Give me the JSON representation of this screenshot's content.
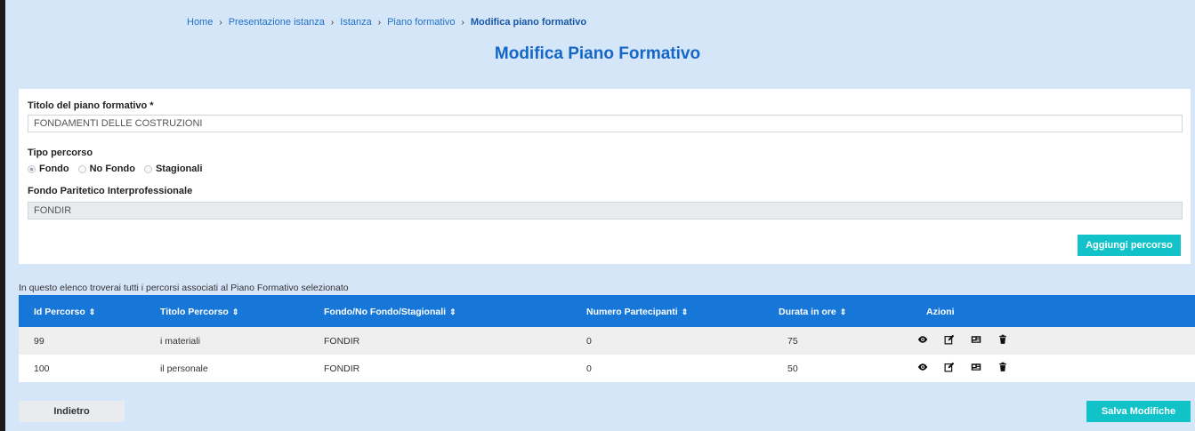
{
  "breadcrumb": {
    "items": [
      "Home",
      "Presentazione istanza",
      "Istanza",
      "Piano formativo"
    ],
    "current": "Modifica piano formativo",
    "separator": "›"
  },
  "page_title": "Modifica Piano Formativo",
  "form": {
    "title_label": "Titolo del piano formativo *",
    "title_value": "FONDAMENTI DELLE COSTRUZIONI",
    "tipo_label": "Tipo percorso",
    "tipo_options": [
      "Fondo",
      "No Fondo",
      "Stagionali"
    ],
    "tipo_selected": "Fondo",
    "fondo_label": "Fondo Paritetico Interprofessionale",
    "fondo_value": "FONDIR",
    "add_button": "Aggiungi percorso"
  },
  "list_info": "In questo elenco troverai tutti i percorsi associati al Piano Formativo selezionato",
  "table": {
    "headers": [
      "Id Percorso",
      "Titolo Percorso",
      "Fondo/No Fondo/Stagionali",
      "Numero Partecipanti",
      "Durata in ore",
      "Azioni"
    ],
    "sort_icon": "⇕",
    "rows": [
      {
        "id": "99",
        "titolo": "i materiali",
        "fondo": "FONDIR",
        "partecipanti": "0",
        "durata": "75"
      },
      {
        "id": "100",
        "titolo": "il personale",
        "fondo": "FONDIR",
        "partecipanti": "0",
        "durata": "50"
      }
    ],
    "action_icons": [
      "eye-icon",
      "edit-icon",
      "id-card-icon",
      "trash-icon"
    ]
  },
  "footer": {
    "back_button": "Indietro",
    "save_button": "Salva Modifiche"
  },
  "colors": {
    "background": "#d6e6f9",
    "title": "#1567c7",
    "table_header": "#1777d9",
    "accent_button": "#11c3c9"
  }
}
